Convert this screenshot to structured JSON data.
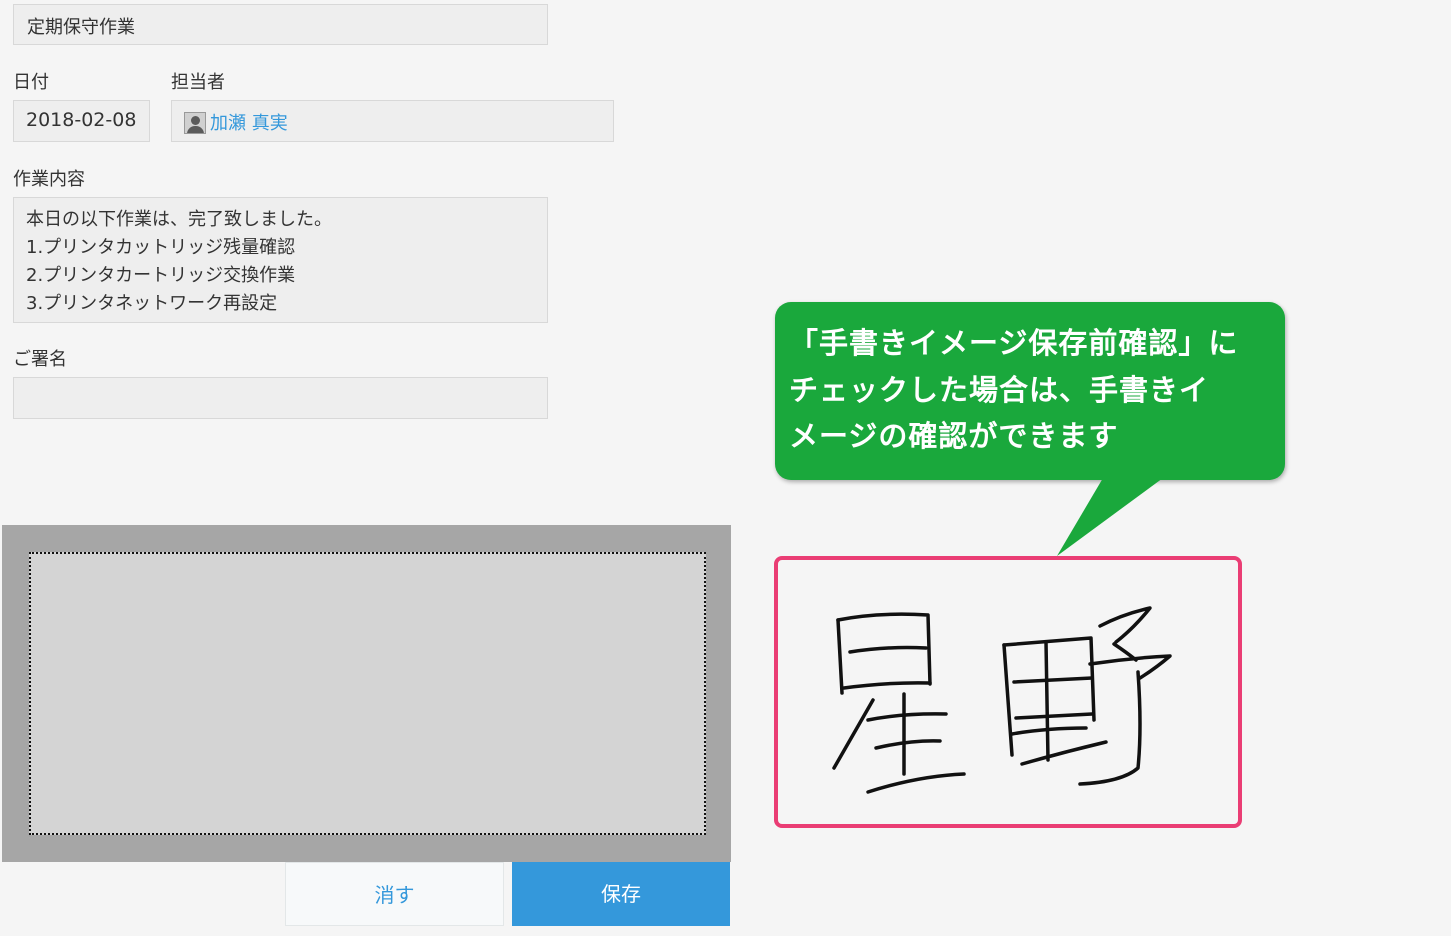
{
  "form": {
    "title": "定期保守作業",
    "date_label": "日付",
    "date_value": "2018-02-08",
    "assignee_label": "担当者",
    "assignee_name": "加瀬 真実",
    "content_label": "作業内容",
    "content_lines": [
      "本日の以下作業は、完了致しました。",
      "1.プリンタカットリッジ残量確認",
      "2.プリンタカートリッジ交換作業",
      "3.プリンタネットワーク再設定"
    ],
    "signature_label": "ご署名",
    "signature_value": ""
  },
  "signature_pad": {
    "clear_label": "消す",
    "save_label": "保存"
  },
  "callout": {
    "lines": [
      "「手書きイメージ保存前確認」に",
      "チェックした場合は、手書きイ",
      "メージの確認ができます"
    ],
    "color": "#1aa83c"
  },
  "preview": {
    "signature_text": "星野",
    "border_color": "#ea3d74"
  },
  "colors": {
    "accent": "#3498db",
    "background": "#f5f5f5"
  }
}
